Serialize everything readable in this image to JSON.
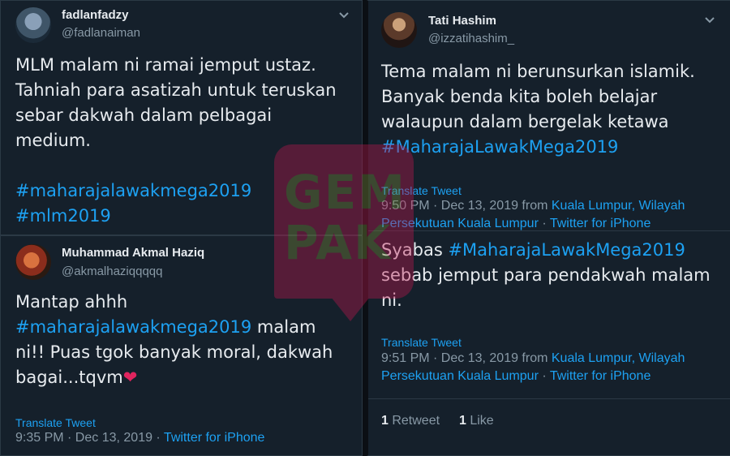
{
  "tweet1": {
    "name": "fadlanfadzy",
    "handle": "@fadlanaiman",
    "lines": [
      "MLM malam ni ramai jemput ustaz.",
      "Tahniah para asatizah untuk teruskan",
      "sebar dakwah dalam pelbagai",
      "medium."
    ],
    "hashtags": [
      "#maharajalawakmega2019",
      "#mlm2019"
    ]
  },
  "tweet2": {
    "name": "Muhammad Akmal Haziq",
    "handle": "@akmalhaziqqqqq",
    "line1": "Mantap ahhh",
    "hashtag": "#maharajalawakmega2019",
    "line2_after": "  malam",
    "line3": "ni!! Puas tgok banyak moral, dakwah",
    "line4": "bagai...tqvm",
    "heart": "❤",
    "translate": "Translate Tweet",
    "time": "9:35 PM · Dec 13, 2019 · ",
    "source": "Twitter for iPhone"
  },
  "tweet3": {
    "name": "Tati Hashim",
    "handle": "@izzatihashim_",
    "lines": [
      "Tema malam ni berunsurkan islamik.",
      "Banyak benda kita boleh belajar",
      "walaupun dalam bergelak ketawa"
    ],
    "hashtag": "#MaharajaLawakMega2019",
    "translate": "Translate Tweet",
    "time": "9:50 PM · Dec 13, 2019 from ",
    "location_1": "Kuala Lumpur, Wilayah",
    "location_2": "Persekutuan Kuala Lumpur",
    "sep": " · ",
    "source": "Twitter for iPhone"
  },
  "tweet4": {
    "lead": "Syabas ",
    "hashtag": "#MaharajaLawakMega2019",
    "line2": "sebab jemput para pendakwah malam",
    "line3": "ni.",
    "translate": "Translate Tweet",
    "time": "9:51 PM · Dec 13, 2019 from ",
    "location_1": "Kuala Lumpur, Wilayah",
    "location_2": "Persekutuan Kuala Lumpur",
    "sep": " · ",
    "source": "Twitter for iPhone",
    "retweet_count": "1",
    "retweet_label": " Retweet",
    "like_count": "1",
    "like_label": " Like"
  },
  "watermark": {
    "line1": "GEM",
    "line2": "PAK"
  },
  "colors": {
    "background": "#15202b",
    "link": "#1da1f2",
    "muted": "#8899a6",
    "heart": "#e0245e"
  },
  "icons": [
    "chevron-down-icon",
    "heart-icon"
  ]
}
